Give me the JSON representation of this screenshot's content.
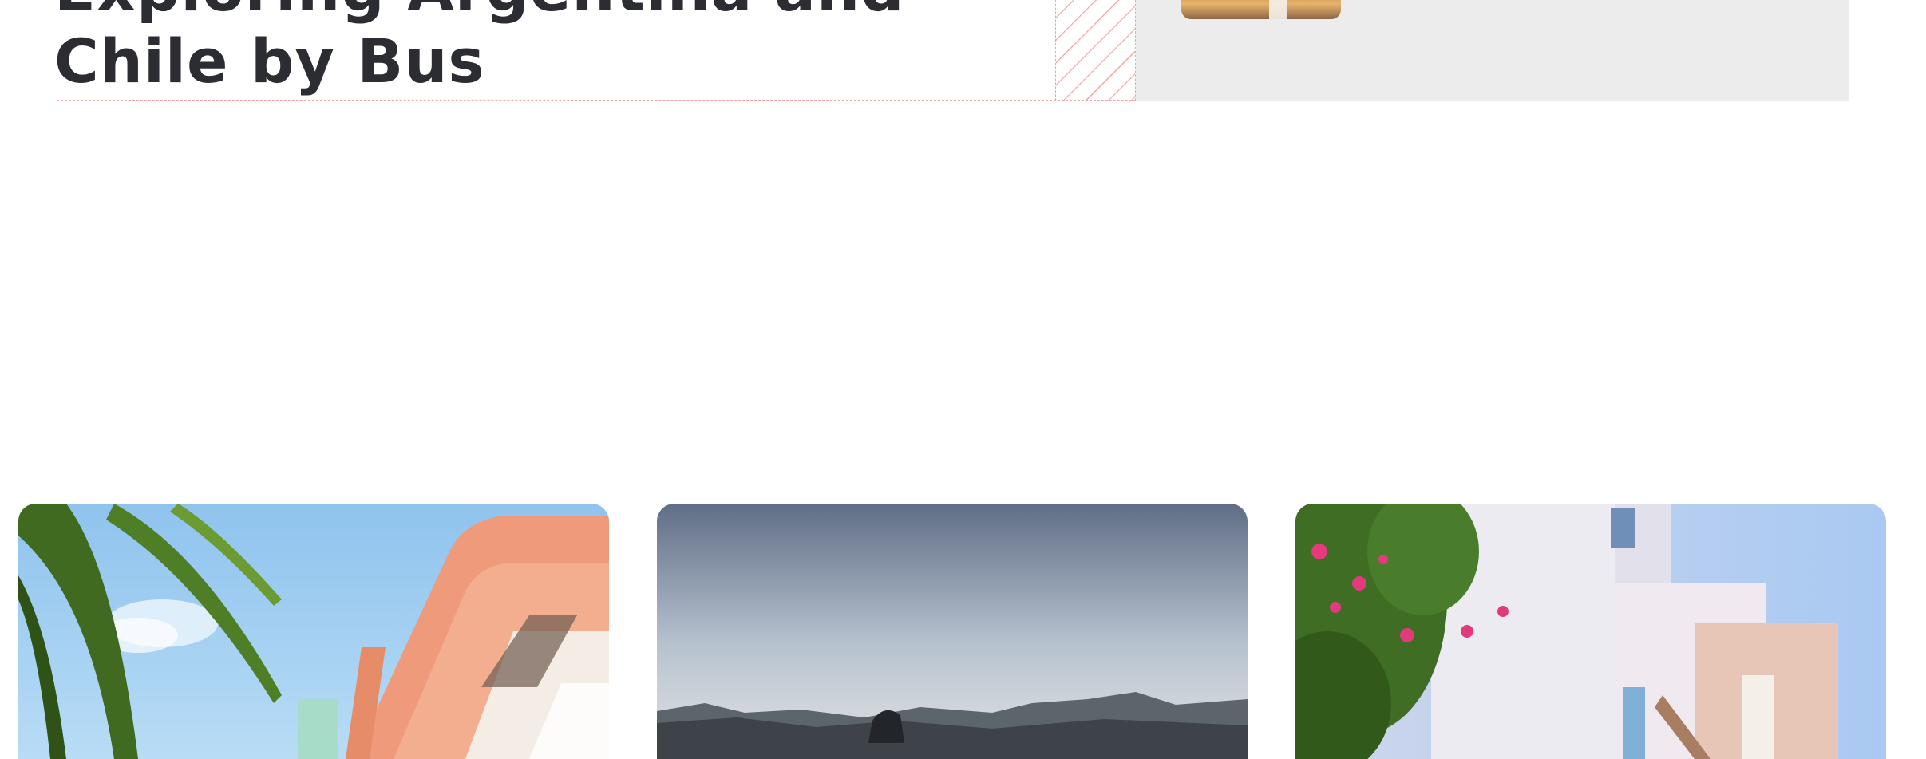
{
  "hero": {
    "title": "Exploring Argentina and Chile by Bus"
  },
  "cards": [
    {
      "image": "art-deco-building-palm-trees"
    },
    {
      "image": "mountain-lake-landscape"
    },
    {
      "image": "whitewashed-village-bougainvillea"
    }
  ]
}
